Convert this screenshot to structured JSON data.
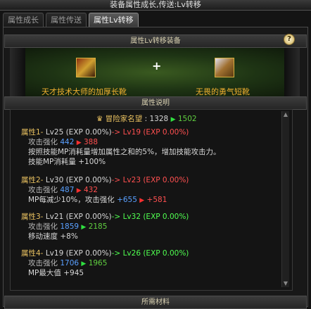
{
  "window": {
    "title": "装备属性成长,传送:Lv转移"
  },
  "tabs": [
    {
      "label": "属性成长"
    },
    {
      "label": "属性传送"
    },
    {
      "label": "属性Lv转移"
    }
  ],
  "transfer": {
    "header": "属性Lv转移装备",
    "help_label": "?",
    "source_item": "天才技术大师的加厚长靴",
    "target_item": "无畏的勇气短靴",
    "plus": "+"
  },
  "desc": {
    "header": "属性说明",
    "fame": {
      "label": "冒险家名望",
      "from": "1328",
      "to": "1502"
    },
    "attrs": [
      {
        "title": "属性1-",
        "from": "Lv25 (EXP 0.00%)",
        "to": "Lv19 (EXP 0.00%)",
        "arrow": "->",
        "stat_label": "攻击强化",
        "stat_from": "442",
        "stat_to": "388",
        "notes": [
          "按照技能MP消耗量增加属性之和的5%，增加技能攻击力。",
          "技能MP消耗量 +100%"
        ]
      },
      {
        "title": "属性2-",
        "from": "Lv30 (EXP 0.00%)",
        "to": "Lv23 (EXP 0.00%)",
        "arrow": "->",
        "stat_label": "攻击强化",
        "stat_from": "487",
        "stat_to": "432",
        "notes": [
          "MP每减少10%，攻击强化"
        ],
        "extra_from": "+655",
        "extra_to": "+581"
      },
      {
        "title": "属性3-",
        "from": "Lv21 (EXP 0.00%)",
        "to": "Lv32 (EXP 0.00%)",
        "arrow": "->",
        "stat_label": "攻击强化",
        "stat_from": "1859",
        "stat_to": "2185",
        "notes": [
          "移动速度 +8%"
        ]
      },
      {
        "title": "属性4-",
        "from": "Lv19 (EXP 0.00%)",
        "to": "Lv26 (EXP 0.00%)",
        "arrow": "->",
        "stat_label": "攻击强化",
        "stat_from": "1706",
        "stat_to": "1965",
        "notes": [
          "MP最大值 +945"
        ]
      }
    ]
  },
  "materials": {
    "header": "所需材料"
  },
  "colors": {
    "gold": "#e8c060",
    "up": "#30e040",
    "down": "#ff3030",
    "blue": "#5aa0ff"
  }
}
